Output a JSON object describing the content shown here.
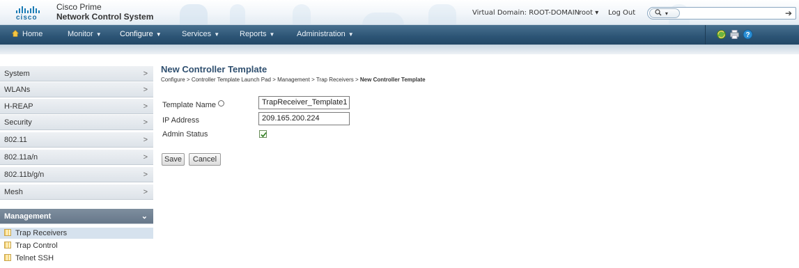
{
  "header": {
    "logo_text": "cisco",
    "product_line1": "Cisco Prime",
    "product_line2": "Network Control System",
    "virtual_domain": "Virtual Domain: ROOT-DOMAIN",
    "user": "root ▾",
    "logout": "Log Out",
    "search_placeholder": "",
    "search_scope_icon": "magnifier-dropdown-icon",
    "go_icon": "arrow-right-icon"
  },
  "nav": {
    "items": [
      {
        "label": "Home",
        "icon": "home-icon"
      },
      {
        "label": "Monitor",
        "dropdown": true
      },
      {
        "label": "Configure",
        "dropdown": true
      },
      {
        "label": "Services",
        "dropdown": true
      },
      {
        "label": "Reports",
        "dropdown": true
      },
      {
        "label": "Administration",
        "dropdown": true
      }
    ],
    "tools": [
      "globe-refresh-icon",
      "printer-icon",
      "help-icon"
    ]
  },
  "sidebar": {
    "items": [
      {
        "label": "System"
      },
      {
        "label": "WLANs"
      },
      {
        "label": "H-REAP"
      },
      {
        "label": "Security"
      },
      {
        "label": "802.11"
      },
      {
        "label": "802.11a/n"
      },
      {
        "label": "802.11b/g/n"
      },
      {
        "label": "Mesh"
      },
      {
        "label": "Management",
        "active": true
      }
    ],
    "sub_items": [
      {
        "label": "Trap Receivers",
        "selected": true
      },
      {
        "label": "Trap Control"
      },
      {
        "label": "Telnet SSH"
      }
    ]
  },
  "main": {
    "title": "New Controller Template",
    "breadcrumb": [
      "Configure",
      "Controller Template Launch Pad",
      "Management",
      "Trap Receivers",
      "New Controller Template"
    ],
    "breadcrumb_sep": ">",
    "form": {
      "template_name_label": "Template Name",
      "template_name_value": "TrapReceiver_Template1",
      "ip_address_label": "IP Address",
      "ip_address_value": "209.165.200.224",
      "admin_status_label": "Admin Status",
      "admin_status_checked": true
    },
    "buttons": {
      "save": "Save",
      "cancel": "Cancel"
    }
  }
}
